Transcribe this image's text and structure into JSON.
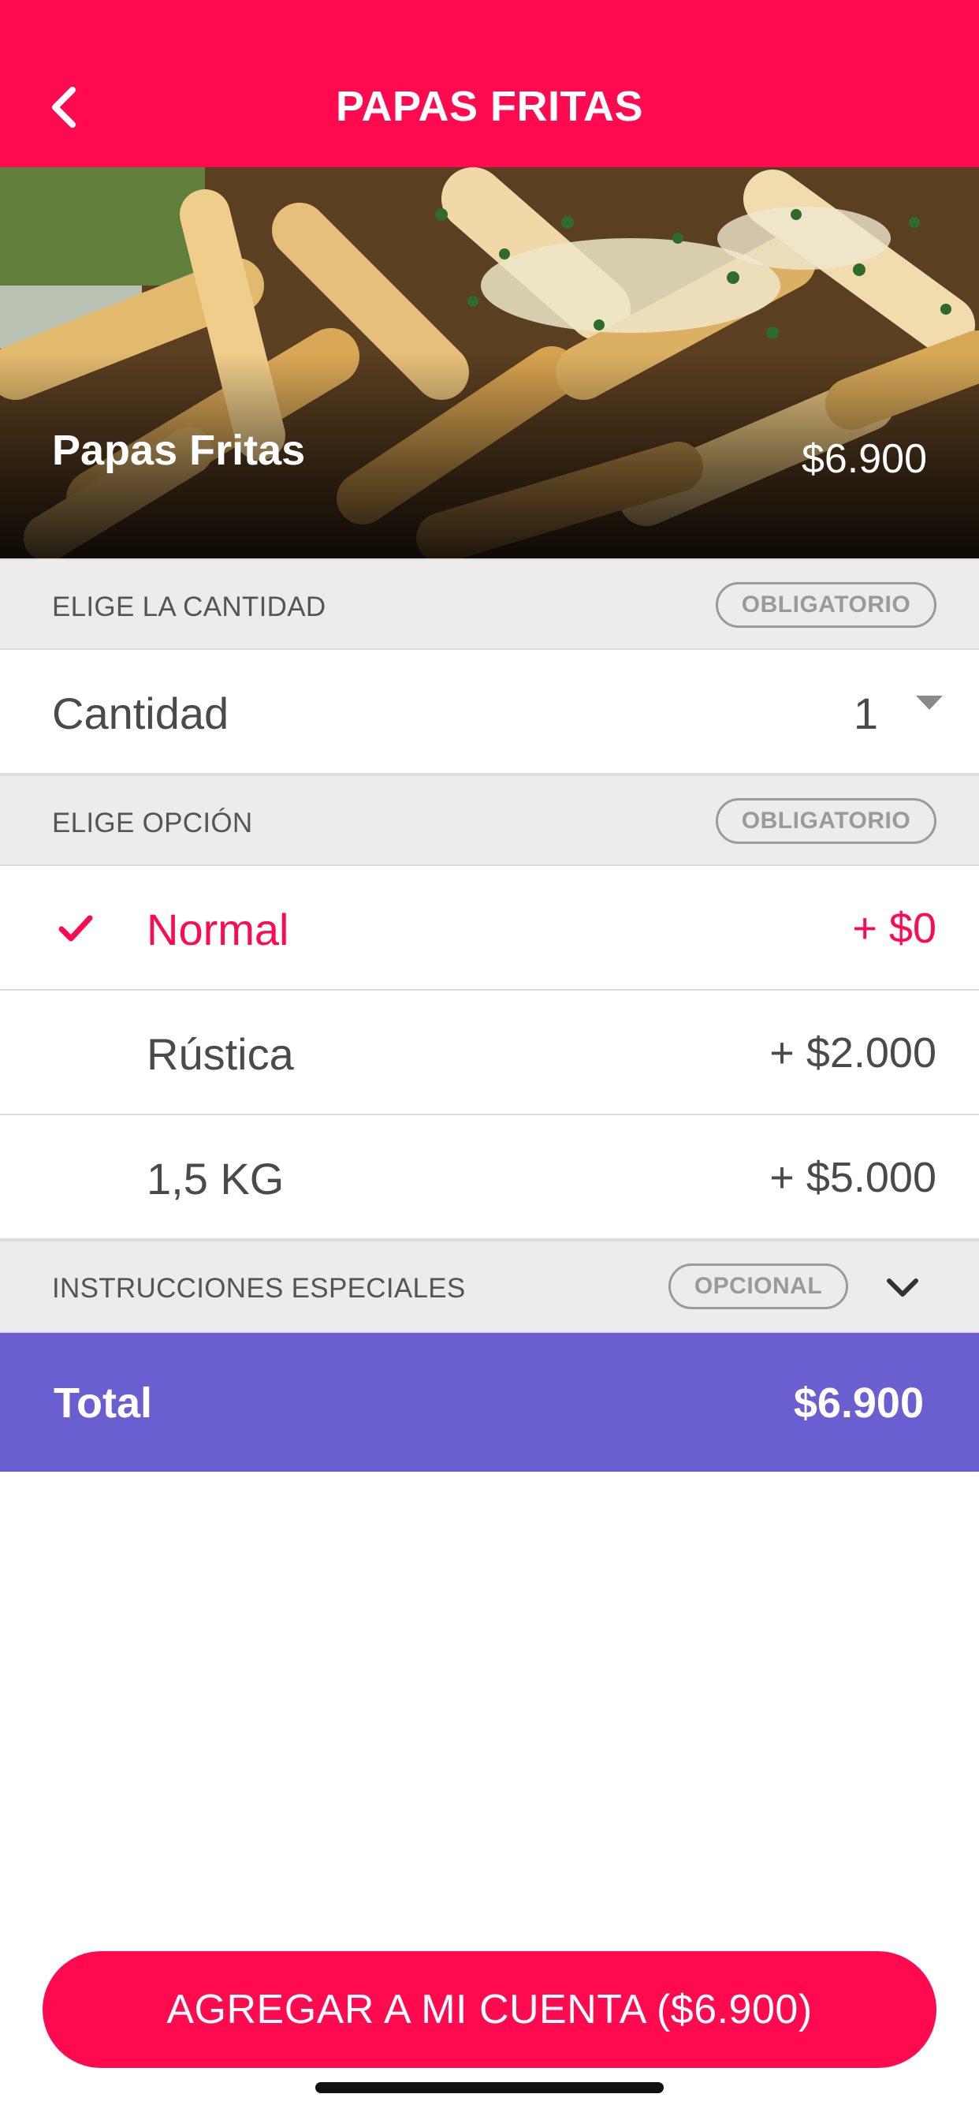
{
  "header": {
    "title": "PAPAS FRITAS",
    "back_icon": "chevron-left-icon"
  },
  "hero": {
    "name": "Papas Fritas",
    "price": "$6.900"
  },
  "quantity_section": {
    "label": "ELIGE LA CANTIDAD",
    "badge": "OBLIGATORIO"
  },
  "quantity": {
    "label": "Cantidad",
    "value": "1"
  },
  "option_section": {
    "label": "ELIGE OPCIÓN",
    "badge": "OBLIGATORIO"
  },
  "options": [
    {
      "label": "Normal",
      "price": "+ $0",
      "selected": true
    },
    {
      "label": "Rústica",
      "price": "+ $2.000",
      "selected": false
    },
    {
      "label": "1,5 KG",
      "price": "+ $5.000",
      "selected": false
    }
  ],
  "instructions_section": {
    "label": "INSTRUCCIONES ESPECIALES",
    "badge": "OPCIONAL"
  },
  "total": {
    "label": "Total",
    "value": "$6.900"
  },
  "cta": {
    "label": "AGREGAR A MI CUENTA ($6.900)"
  },
  "colors": {
    "brand": "#ff0a50",
    "total_bar": "#6a5fd0",
    "section_bg": "#ececec"
  }
}
